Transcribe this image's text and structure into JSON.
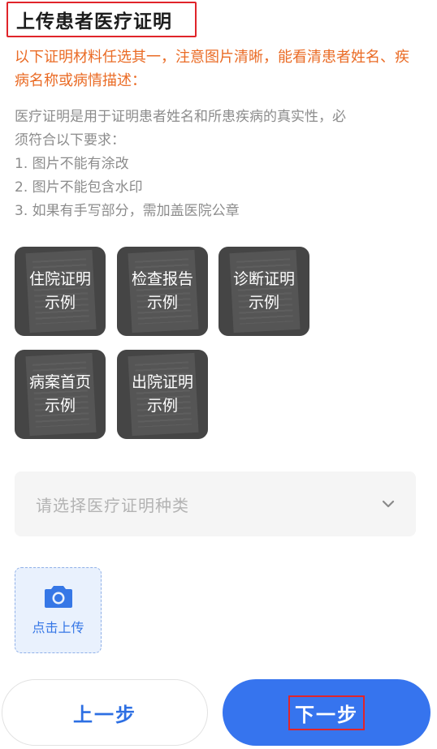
{
  "header": {
    "title": "上传患者医疗证明"
  },
  "notice": "以下证明材料任选其一，注意图片清晰，能看清患者姓名、疾病名称或病情描述：",
  "description": {
    "intro_line1": "医疗证明是用于证明患者姓名和所患疾病的真实性，必",
    "intro_line2": "须符合以下要求：",
    "req1": "1. 图片不能有涂改",
    "req2": "2. 图片不能包含水印",
    "req3": "3. 如果有手写部分，需加盖医院公章"
  },
  "examples": [
    {
      "line1": "住院证明",
      "line2": "示例"
    },
    {
      "line1": "检查报告",
      "line2": "示例"
    },
    {
      "line1": "诊断证明",
      "line2": "示例"
    },
    {
      "line1": "病案首页",
      "line2": "示例"
    },
    {
      "line1": "出院证明",
      "line2": "示例"
    }
  ],
  "select": {
    "placeholder": "请选择医疗证明种类"
  },
  "upload": {
    "label": "点击上传"
  },
  "footer": {
    "prev_label": "上一步",
    "next_label": "下一步"
  },
  "colors": {
    "accent": "#3674ee",
    "notice": "#ea6b25",
    "highlight_border": "#e0242a"
  }
}
